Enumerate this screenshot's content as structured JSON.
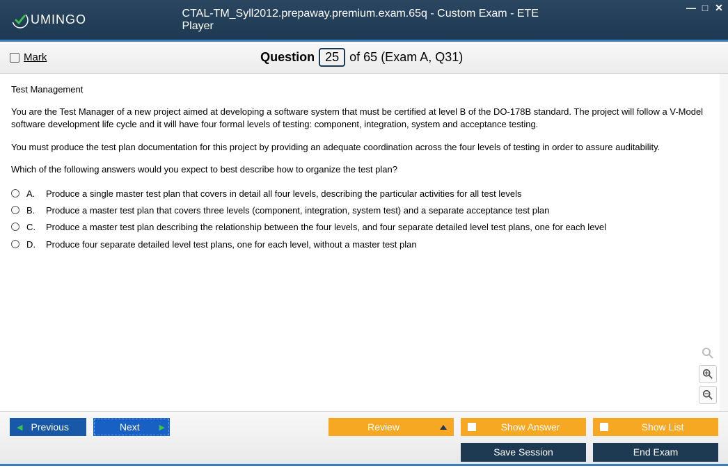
{
  "window": {
    "title": "CTAL-TM_Syll2012.prepaway.premium.exam.65q - Custom Exam - ETE Player",
    "brand": "UMINGO"
  },
  "qbar": {
    "mark_label": "Mark",
    "question_word": "Question",
    "question_no": "25",
    "of_text": "of 65 (Exam A, Q31)"
  },
  "content": {
    "topic": "Test Management",
    "para1": "You are the Test Manager of a new project aimed at developing a software system that must be certified at level B of the DO-178B standard. The project will follow a V-Model software development life cycle and it will have four formal levels of testing: component, integration, system and acceptance testing.",
    "para2": "You must produce the test plan documentation for this project by providing an adequate coordination across the four levels of testing in order to assure auditability.",
    "para3": "Which of the following answers would you expect to best describe how to organize the test plan?",
    "answers": [
      {
        "letter": "A.",
        "text": "Produce a single master test plan that covers in detail all four levels, describing the particular activities for all test levels"
      },
      {
        "letter": "B.",
        "text": "Produce a master test plan that covers three levels (component, integration, system test) and a separate acceptance test plan"
      },
      {
        "letter": "C.",
        "text": "Produce a master test plan describing the relationship between the four levels, and four separate detailed level test plans, one for each level"
      },
      {
        "letter": "D.",
        "text": "Produce four separate detailed level test plans, one for each level, without a master test plan"
      }
    ]
  },
  "footer": {
    "previous": "Previous",
    "next": "Next",
    "review": "Review",
    "show_answer": "Show Answer",
    "show_list": "Show List",
    "save_session": "Save Session",
    "end_exam": "End Exam"
  }
}
